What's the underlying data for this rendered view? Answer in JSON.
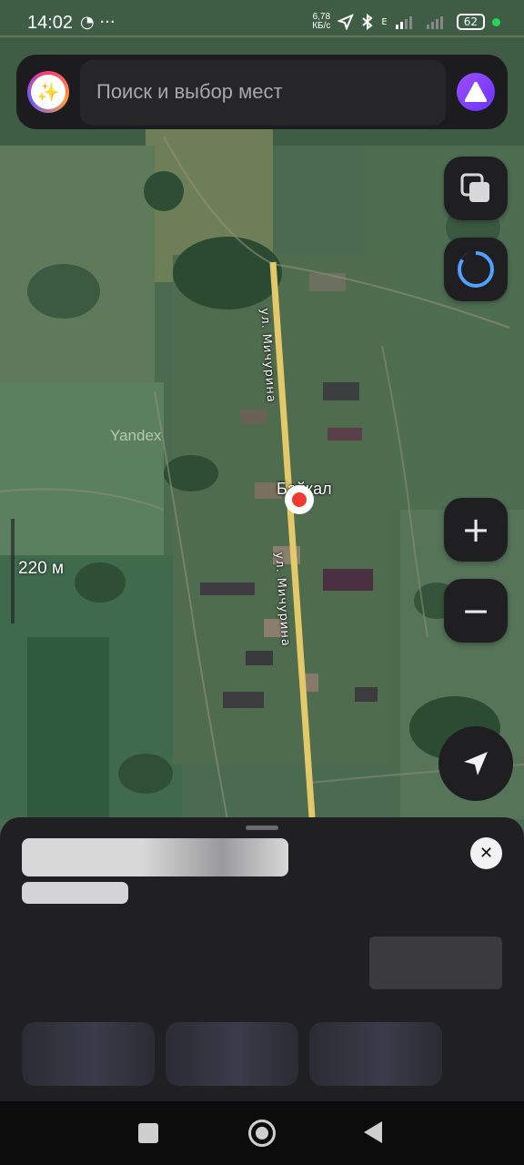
{
  "status_bar": {
    "time": "14:02",
    "left_icons": "◔ ···",
    "net_speed_value": "6,78",
    "net_speed_unit": "КБ/с",
    "network_type": "E",
    "battery": "62"
  },
  "search": {
    "placeholder": "Поиск и выбор мест",
    "avatar_icon": "sparkles-icon",
    "assistant_icon": "alice-icon"
  },
  "map": {
    "watermark": "Yandex",
    "scale_label": "220 м",
    "place_label": "Байкал",
    "street_label": "ул. Мичурина",
    "street_label_2": "ул. Мичурина"
  },
  "controls": {
    "layers_icon": "layers-icon",
    "alice_ring_icon": "alice-ring-icon",
    "zoom_in": "+",
    "zoom_out": "−",
    "location_icon": "navigation-arrow-icon"
  },
  "sheet": {
    "close": "✕"
  },
  "colors": {
    "road": "#e3c96a",
    "accent": "#7a3cff",
    "pin": "#f03a2e"
  }
}
